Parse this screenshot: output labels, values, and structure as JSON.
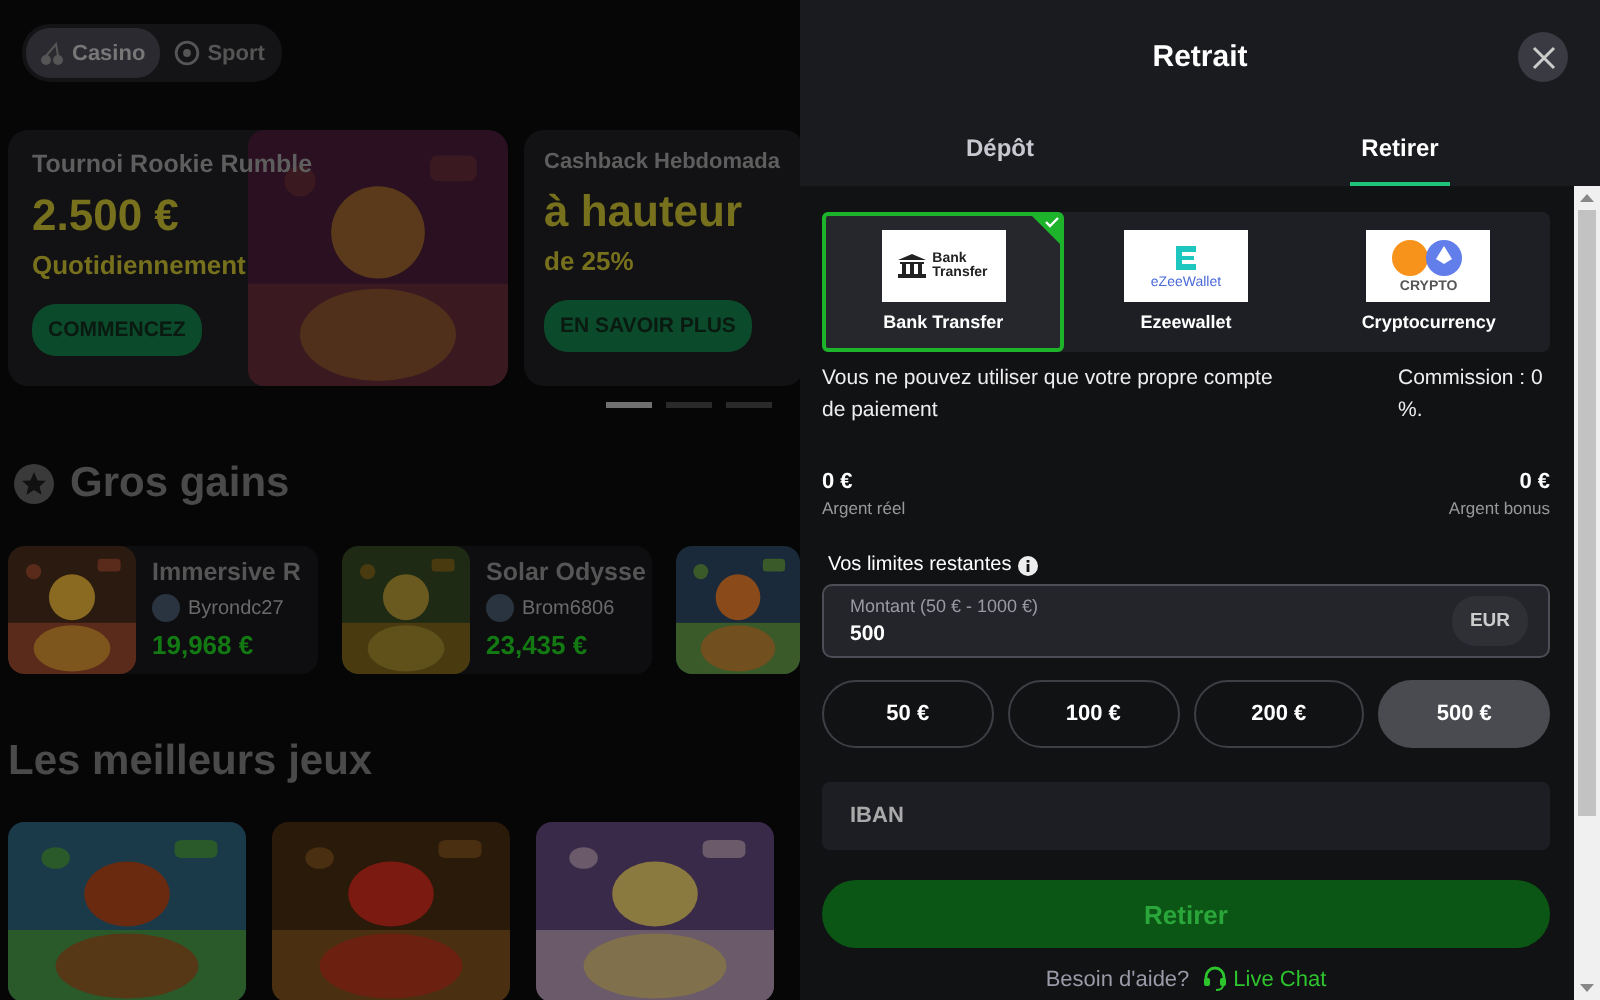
{
  "site": {
    "nav_tabs": [
      {
        "label": "Casino",
        "selected": true
      },
      {
        "label": "Sport",
        "selected": false
      }
    ],
    "promos": [
      {
        "title": "Tournoi Rookie Rumble",
        "headline": "2.500 €",
        "subline": "Quotidiennement",
        "button": "COMMENCEZ"
      },
      {
        "title": "Cashback Hebdomada",
        "headline": "à hauteur",
        "subline": "de 25%",
        "button": "EN SAVOIR PLUS"
      }
    ],
    "carousel_dots": [
      {
        "selected": true
      },
      {
        "selected": false
      },
      {
        "selected": false
      }
    ],
    "big_wins": {
      "title": "Gros gains",
      "items": [
        {
          "game": "Immersive R",
          "player": "Byrondc27",
          "amount": "19,968 €"
        },
        {
          "game": "Solar Odysse",
          "player": "Brom6806",
          "amount": "23,435 €"
        },
        {
          "kind": "picture"
        }
      ]
    },
    "top_games": {
      "title": "Les meilleurs jeux",
      "games": [
        {
          "kind": "picture"
        },
        {
          "kind": "picture"
        },
        {
          "kind": "picture"
        }
      ]
    }
  },
  "withdraw": {
    "title": "Retrait",
    "tabs": [
      {
        "label": "Dépôt",
        "selected": false
      },
      {
        "label": "Retirer",
        "selected": true
      }
    ],
    "methods": [
      {
        "kind": "bank",
        "logo_text": "Bank Transfer",
        "label": "Bank Transfer",
        "selected": true
      },
      {
        "kind": "ewallet",
        "logo_text": "eZeeWallet",
        "label": "Ezeewallet",
        "selected": false
      },
      {
        "kind": "crypto",
        "logo_text": "CRYPTO",
        "label": "Cryptocurrency",
        "selected": false
      }
    ],
    "notice": "Vous ne pouvez utiliser que votre propre compte de paiement",
    "commission": "Commission : 0 %.",
    "balances": [
      {
        "amount": "0 €",
        "label": "Argent réel"
      },
      {
        "amount": "0 €",
        "label": "Argent bonus"
      }
    ],
    "limits_label": "Vos limites restantes",
    "amount_field": {
      "label": "Montant (50 € - 1000 €)",
      "value": "500",
      "currency": "EUR"
    },
    "presets": [
      {
        "label": "50 €",
        "selected": false
      },
      {
        "label": "100 €",
        "selected": false
      },
      {
        "label": "200 €",
        "selected": false
      },
      {
        "label": "500 €",
        "selected": true
      }
    ],
    "iban_field": {
      "placeholder": "IBAN"
    },
    "submit": "Retirer",
    "help": {
      "text": "Besoin d'aide?",
      "link": "Live Chat"
    }
  }
}
